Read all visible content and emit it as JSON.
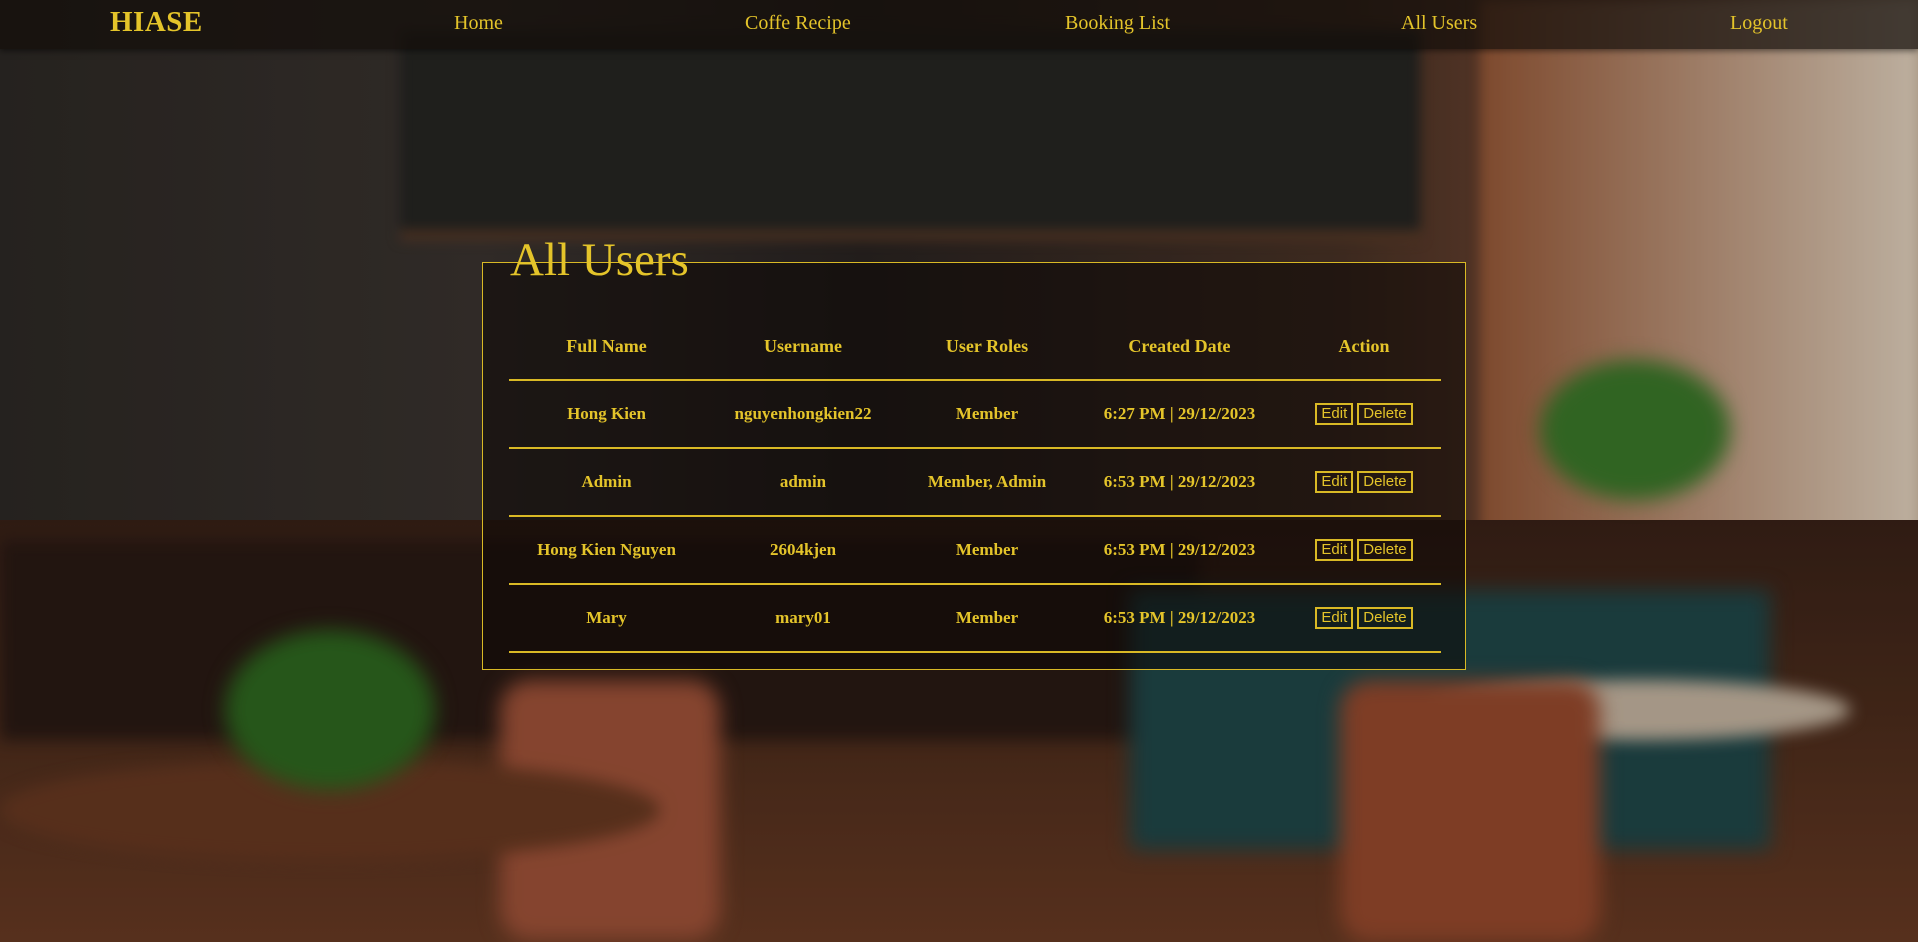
{
  "nav": {
    "brand": "HIASE",
    "home": "Home",
    "recipe": "Coffe Recipe",
    "booking": "Booking List",
    "users": "All Users",
    "logout": "Logout"
  },
  "panel": {
    "title": "All Users",
    "columns": [
      "Full Name",
      "Username",
      "User Roles",
      "Created Date",
      "Action"
    ],
    "edit_label": "Edit",
    "delete_label": "Delete",
    "rows": [
      {
        "full_name": "Hong Kien",
        "username": "nguyenhongkien22",
        "roles": "Member",
        "created": "6:27 PM | 29/12/2023"
      },
      {
        "full_name": "Admin",
        "username": "admin",
        "roles": "Member, Admin",
        "created": "6:53 PM | 29/12/2023"
      },
      {
        "full_name": "Hong Kien Nguyen",
        "username": "2604kjen",
        "roles": "Member",
        "created": "6:53 PM | 29/12/2023"
      },
      {
        "full_name": "Mary",
        "username": "mary01",
        "roles": "Member",
        "created": "6:53 PM | 29/12/2023"
      }
    ]
  },
  "colors": {
    "accent": "#e4c42a",
    "nav_bg": "#140e0a"
  }
}
